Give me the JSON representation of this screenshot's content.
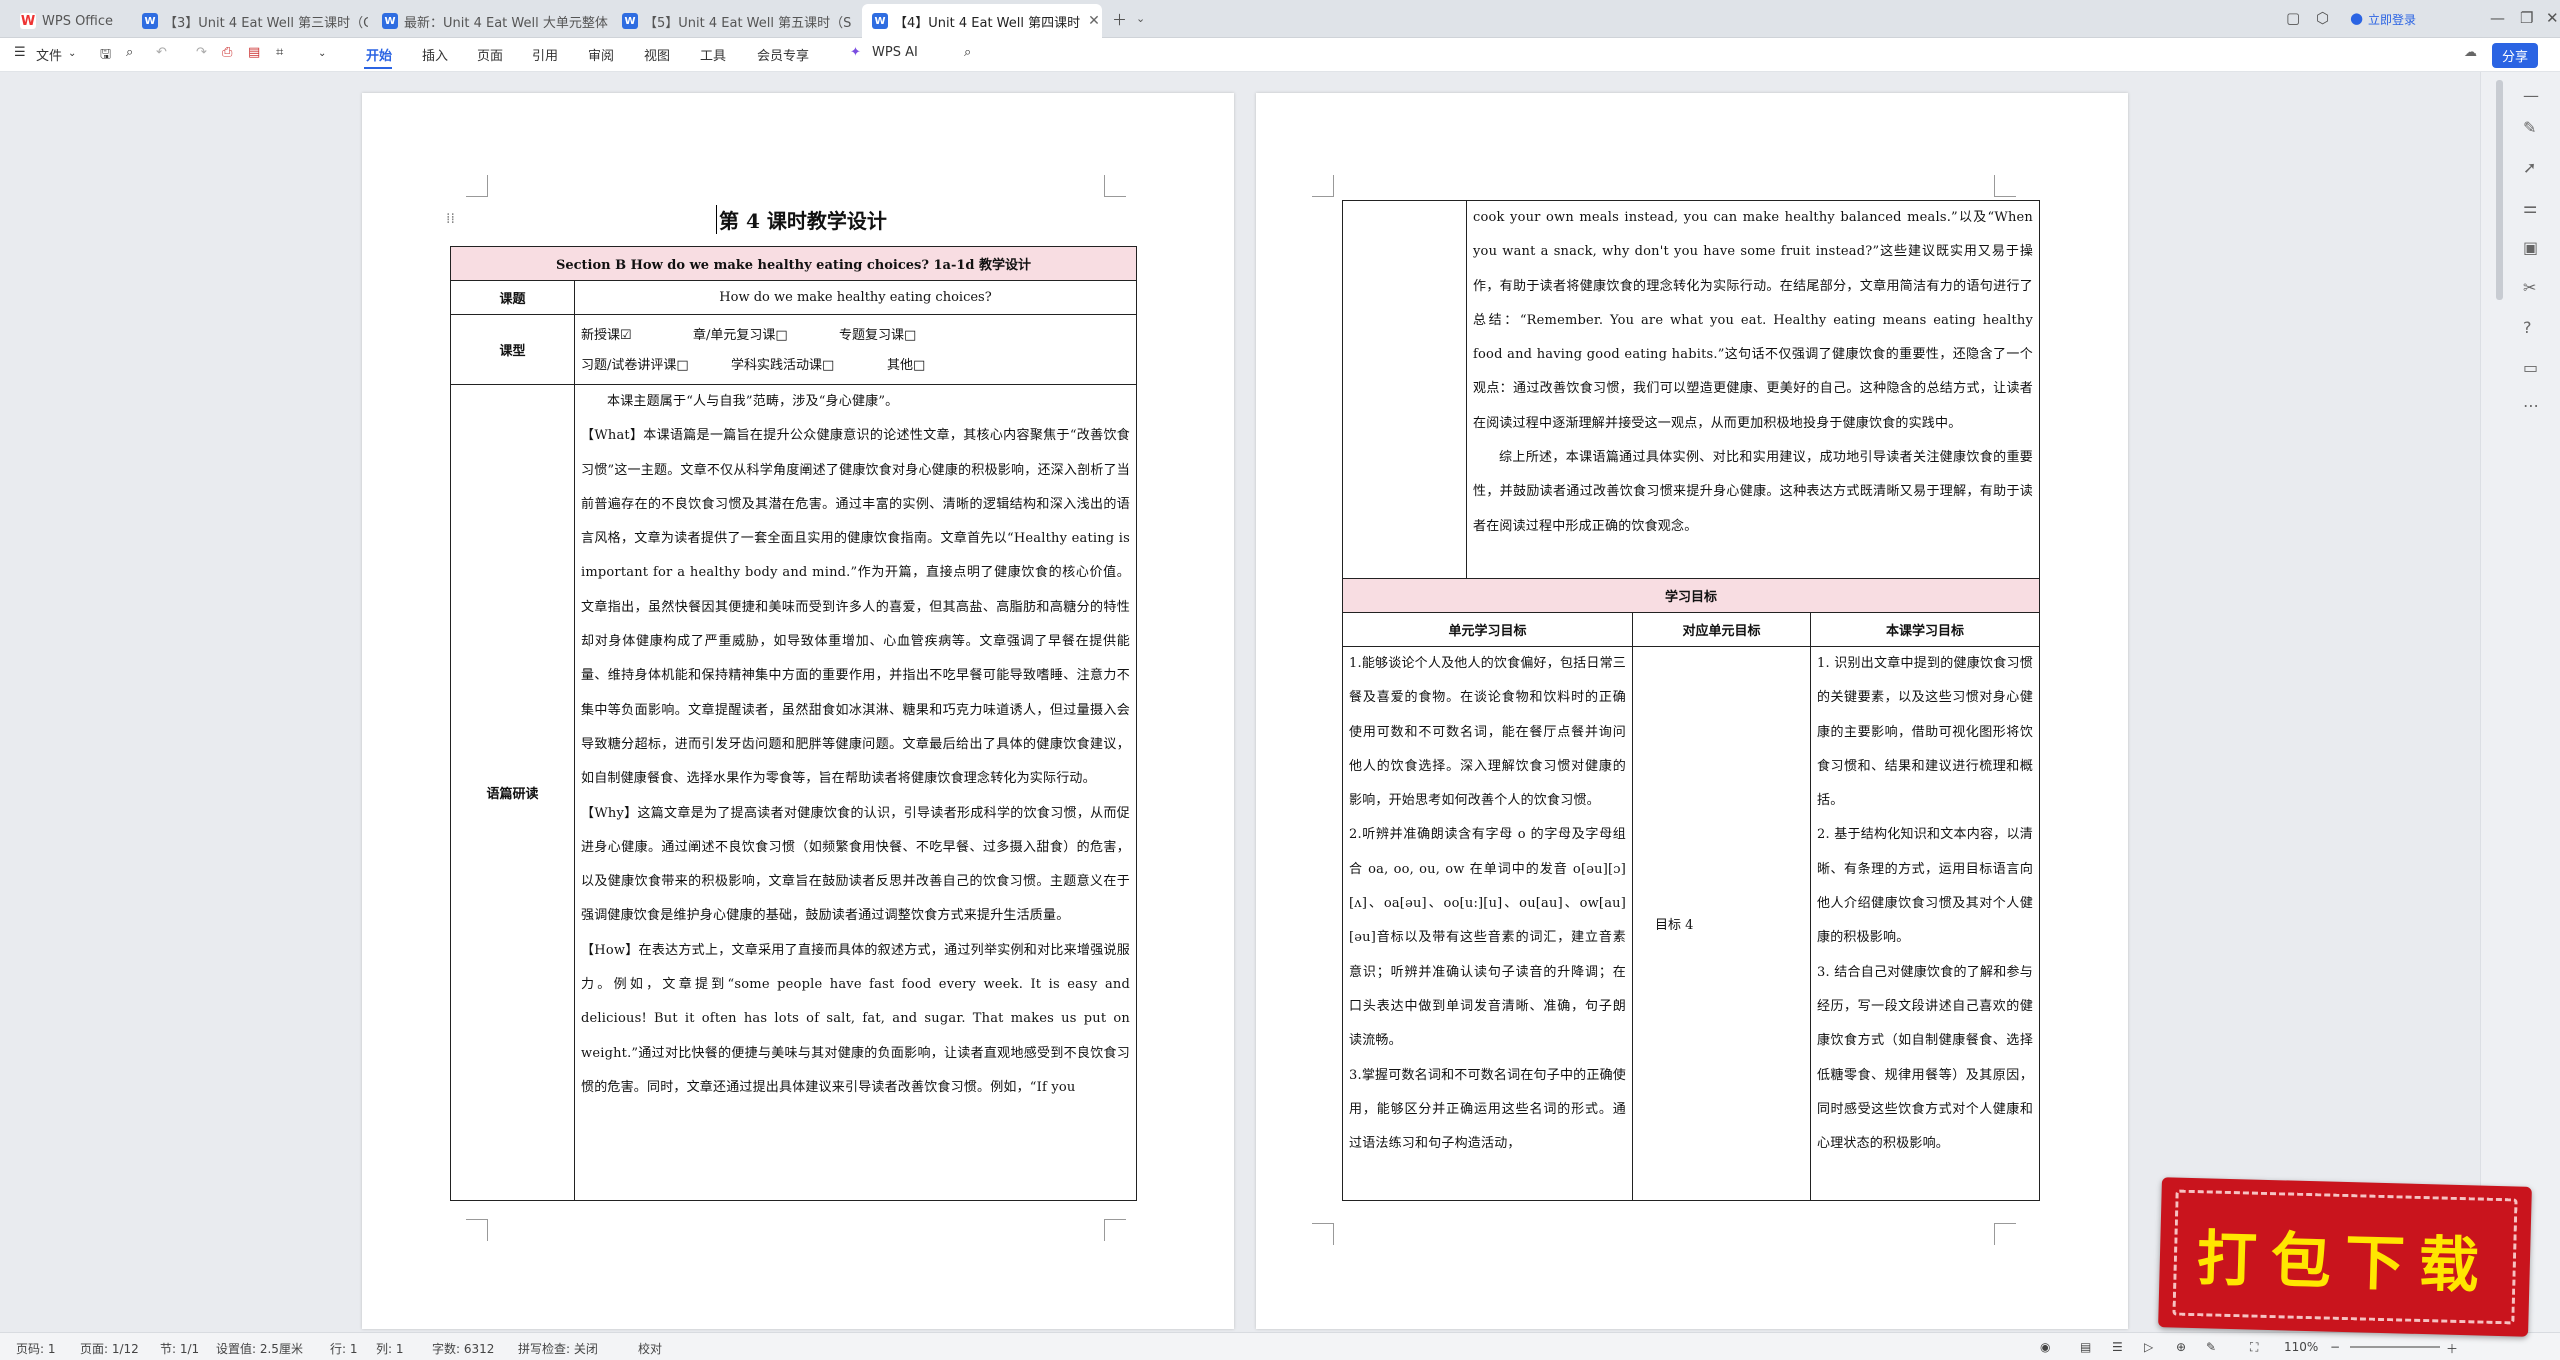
{
  "tabs": [
    {
      "label": "WPS Office",
      "icon": "wps-logo-icon"
    },
    {
      "label": "【3】Unit 4 Eat Well 第三课时（Gra",
      "icon": "w-doc-icon"
    },
    {
      "label": "最新：Unit 4 Eat Well 大单元整体设",
      "icon": "w-doc-icon"
    },
    {
      "label": "【5】Unit 4 Eat Well 第五课时（Sec",
      "icon": "w-doc-icon"
    },
    {
      "label": "【4】Unit 4 Eat Well 第四课时",
      "icon": "w-doc-icon",
      "active": true
    }
  ],
  "login": "立即登录",
  "toolbar": {
    "file": "文件",
    "menus": [
      "开始",
      "插入",
      "页面",
      "引用",
      "审阅",
      "视图",
      "工具",
      "会员专享"
    ],
    "ai": "WPS AI",
    "share": "分享"
  },
  "page1": {
    "title": "第 4 课时教学设计",
    "section_header": "Section B How do we make healthy eating choices? 1a-1d 教学设计",
    "topic_label": "课题",
    "topic_value": "How do we make healthy eating choices?",
    "type_label": "课型",
    "type_row1": [
      "新授课☑",
      "章/单元复习课□",
      "专题复习课□"
    ],
    "type_row2": [
      "习题/试卷讲评课□",
      "学科实践活动课□",
      "其他□"
    ],
    "analysis_label": "语篇研读",
    "paragraphs": [
      "本课主题属于“人与自我”范畴，涉及“身心健康”。",
      "【What】本课语篇是一篇旨在提升公众健康意识的论述性文章，其核心内容聚焦于“改善饮食习惯”这一主题。文章不仅从科学角度阐述了健康饮食对身心健康的积极影响，还深入剖析了当前普遍存在的不良饮食习惯及其潜在危害。通过丰富的实例、清晰的逻辑结构和深入浅出的语言风格，文章为读者提供了一套全面且实用的健康饮食指南。文章首先以“Healthy eating is important for a healthy body and mind.”作为开篇，直接点明了健康饮食的核心价值。文章指出，虽然快餐因其便捷和美味而受到许多人的喜爱，但其高盐、高脂肪和高糖分的特性却对身体健康构成了严重威胁，如导致体重增加、心血管疾病等。文章强调了早餐在提供能量、维持身体机能和保持精神集中方面的重要作用，并指出不吃早餐可能导致嗜睡、注意力不集中等负面影响。文章提醒读者，虽然甜食如冰淇淋、糖果和巧克力味道诱人，但过量摄入会导致糖分超标，进而引发牙齿问题和肥胖等健康问题。文章最后给出了具体的健康饮食建议，如自制健康餐食、选择水果作为零食等，旨在帮助读者将健康饮食理念转化为实际行动。",
      "【Why】这篇文章是为了提高读者对健康饮食的认识，引导读者形成科学的饮食习惯，从而促进身心健康。通过阐述不良饮食习惯（如频繁食用快餐、不吃早餐、过多摄入甜食）的危害，以及健康饮食带来的积极影响，文章旨在鼓励读者反思并改善自己的饮食习惯。主题意义在于强调健康饮食是维护身心健康的基础，鼓励读者通过调整饮食方式来提升生活质量。",
      "【How】在表达方式上，文章采用了直接而具体的叙述方式，通过列举实例和对比来增强说服力。例如，文章提到“some people have fast food every week. It is easy and delicious! But it often has lots of salt, fat, and sugar. That makes us put on weight.”通过对比快餐的便捷与美味与其对健康的负面影响，让读者直观地感受到不良饮食习惯的危害。同时，文章还通过提出具体建议来引导读者改善饮食习惯。例如，“If you"
    ]
  },
  "page2": {
    "continued": [
      "cook your own meals instead, you can make healthy balanced meals.”以及“When you want a snack, why don't you have some fruit instead?”这些建议既实用又易于操作，有助于读者将健康饮食的理念转化为实际行动。在结尾部分，文章用简洁有力的语句进行了总结：“Remember. You are what you eat. Healthy eating means eating healthy food and having good eating habits.”这句话不仅强调了健康饮食的重要性，还隐含了一个观点：通过改善饮食习惯，我们可以塑造更健康、更美好的自己。这种隐含的总结方式，让读者在阅读过程中逐渐理解并接受这一观点，从而更加积极地投身于健康饮食的实践中。",
      "综上所述，本课语篇通过具体实例、对比和实用建议，成功地引导读者关注健康饮食的重要性，并鼓励读者通过改善饮食习惯来提升身心健康。这种表达方式既清晰又易于理解，有助于读者在阅读过程中形成正确的饮食观念。"
    ],
    "objectives_header": "学习目标",
    "col_headers": [
      "单元学习目标",
      "对应单元目标",
      "本课学习目标"
    ],
    "unit_goals": [
      "1.能够谈论个人及他人的饮食偏好，包括日常三餐及喜爱的食物。在谈论食物和饮料时的正确使用可数和不可数名词，能在餐厅点餐并询问他人的饮食选择。深入理解饮食习惯对健康的影响，开始思考如何改善个人的饮食习惯。",
      "2.听辨并准确朗读含有字母 o 的字母及字母组合 oa, oo, ou, ow 在单词中的发音 o[əu][ɔ] [ʌ]、oa[əu]、oo[u:][u]、ou[au]、ow[au][əu]音标以及带有这些音素的词汇，建立音素意识；听辨并准确认读句子读音的升降调；在口头表达中做到单词发音清晰、准确，句子朗读流畅。",
      "3.掌握可数名词和不可数名词在句子中的正确使用，能够区分并正确运用这些名词的形式。通过语法练习和句子构造活动，"
    ],
    "mapped_goal": "目标 4",
    "lesson_goals": [
      "1. 识别出文章中提到的健康饮食习惯的关键要素，以及这些习惯对身心健康的主要影响，借助可视化图形将饮食习惯和、结果和建议进行梳理和概括。",
      "2. 基于结构化知识和文本内容，以清晰、有条理的方式，运用目标语言向他人介绍健康饮食习惯及其对个人健康的积极影响。",
      "3. 结合自己对健康饮食的了解和参与经历，写一段文段讲述自己喜欢的健康饮食方式（如自制健康餐食、选择低糖零食、规律用餐等）及其原因，同时感受这些饮食方式对个人健康和心理状态的积极影响。"
    ]
  },
  "status": {
    "page_no": "页码: 1",
    "pages": "页面: 1/12",
    "section": "节: 1/1",
    "setting": "设置值: 2.5厘米",
    "row": "行: 1",
    "col": "列: 1",
    "words": "字数: 6312",
    "spell": "拼写检查: 关闭",
    "proof": "校对",
    "zoom": "110%"
  },
  "promo": "打包下载"
}
